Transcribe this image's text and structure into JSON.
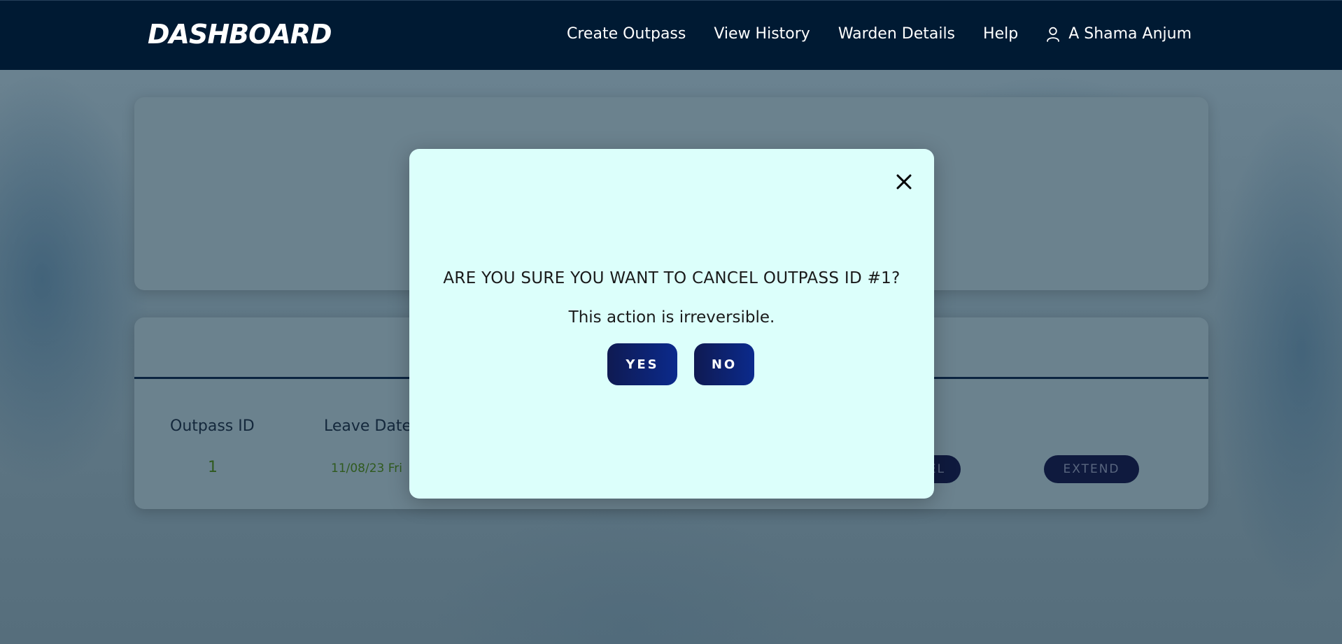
{
  "nav": {
    "brand": "DASHBOARD",
    "links": [
      "Create Outpass",
      "View History",
      "Warden Details",
      "Help"
    ],
    "user_name": "A Shama Anjum",
    "user_icon": "user-icon"
  },
  "table": {
    "headers": [
      "Outpass ID",
      "Leave Date"
    ],
    "rows": [
      {
        "outpass_id": "1",
        "leave_date": "11/08/23 Fri",
        "cancel_label": "EL",
        "extend_label": "EXTEND"
      }
    ]
  },
  "modal": {
    "question": "ARE YOU SURE YOU WANT TO CANCEL OUTPASS ID #1?",
    "subtext": "This action is irreversible.",
    "yes_label": "YES",
    "no_label": "NO",
    "close_icon": "close-icon"
  },
  "colors": {
    "navbar": "#001a33",
    "modal_bg": "#dcfffb",
    "button_start": "#0f1a52",
    "button_end": "#0b2a8c"
  }
}
